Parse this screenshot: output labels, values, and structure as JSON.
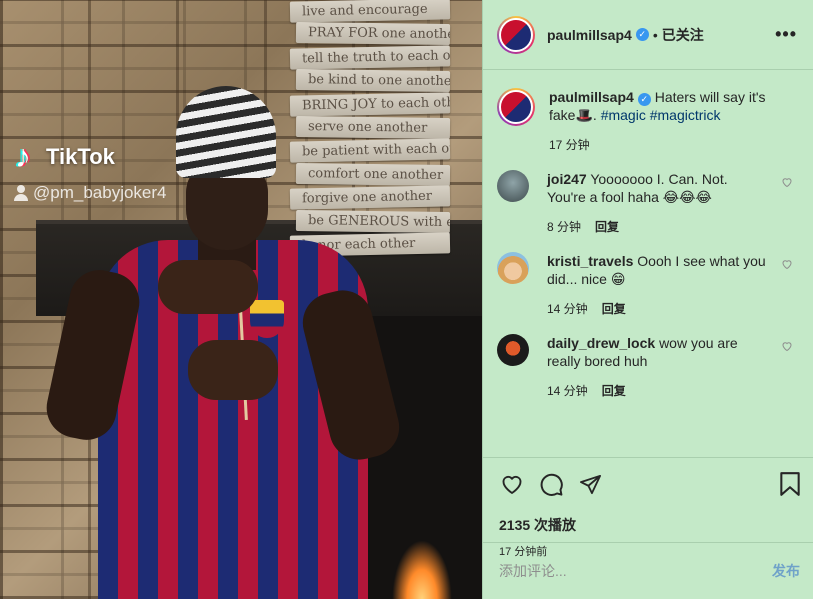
{
  "video": {
    "watermark": {
      "brand": "TikTok",
      "handle": "@pm_babyjoker4"
    },
    "signs": [
      "live and encourage",
      "PRAY FOR one another",
      "tell the truth to each other",
      "be kind to one another",
      "BRING JOY to each other",
      "serve one another",
      "be patient with each other",
      "comfort one another",
      "forgive one another",
      "be GENEROUS with each other",
      "honor each other"
    ]
  },
  "header": {
    "username": "paulmillsap4",
    "separator": "•",
    "follow_label": "已关注",
    "more": "•••"
  },
  "caption": {
    "username": "paulmillsap4",
    "text": "Haters will say it's fake🎩. ",
    "tags": [
      "#magic",
      "#magictrick"
    ],
    "time": "17 分钟"
  },
  "comments": [
    {
      "username": "joi247",
      "text": "Yooooooo I. Can. Not. You're a fool haha 😂😂😂",
      "time": "8 分钟",
      "reply": "回复"
    },
    {
      "username": "kristi_travels",
      "text": "Oooh I see what you did... nice 😁",
      "time": "14 分钟",
      "reply": "回复"
    },
    {
      "username": "daily_drew_lock",
      "text": "wow you are really bored huh",
      "time": "14 分钟",
      "reply": "回复"
    }
  ],
  "stats": {
    "views": "2135 次播放",
    "posted": "17 分钟前"
  },
  "add_comment": {
    "placeholder": "添加评论...",
    "post_label": "发布"
  },
  "colors": {
    "panel_bg": "#c4e9c8",
    "link": "#00376b",
    "verified": "#3897f0"
  }
}
